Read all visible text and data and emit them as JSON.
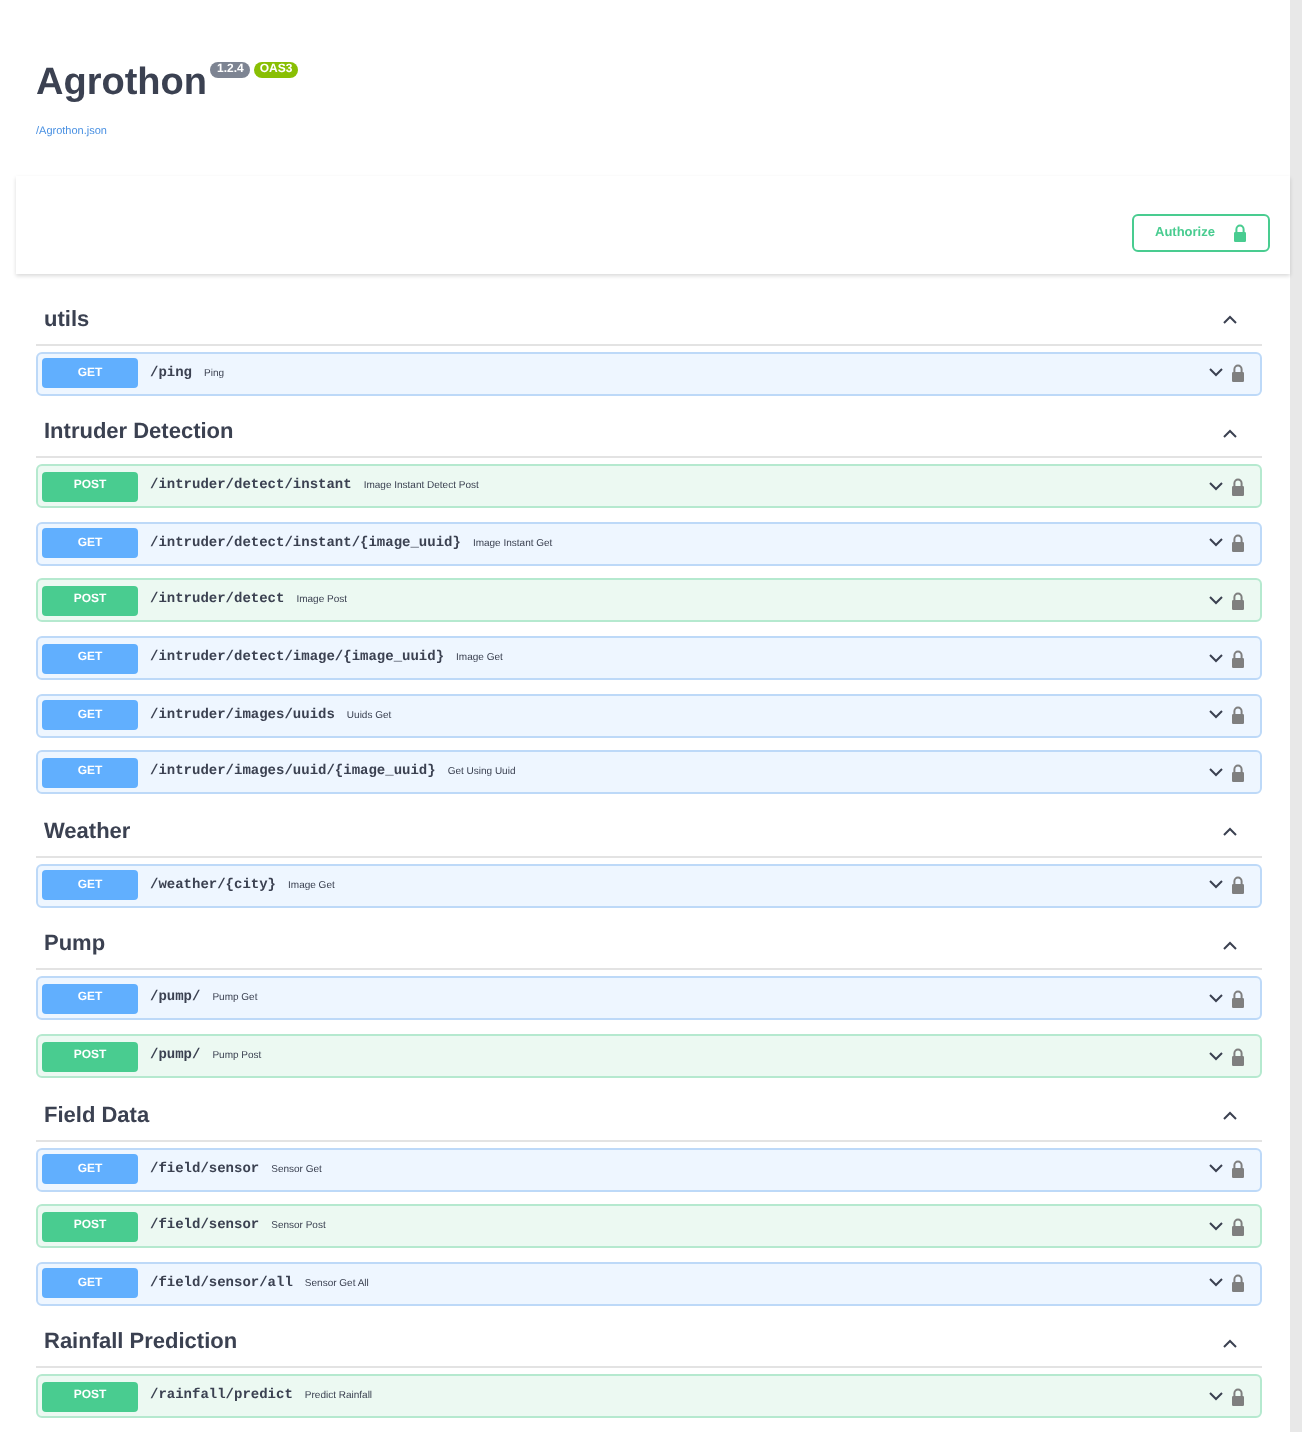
{
  "header": {
    "title": "Agrothon",
    "version": "1.2.4",
    "spec": "OAS3",
    "link": "/Agrothon.json"
  },
  "authorize": {
    "label": "Authorize"
  },
  "sections": [
    {
      "name": "utils",
      "expanded": true,
      "operations": [
        {
          "kind": "get",
          "method": "GET",
          "path": "/ping",
          "summary": "Ping"
        }
      ]
    },
    {
      "name": "Intruder Detection",
      "expanded": true,
      "operations": [
        {
          "kind": "post",
          "method": "POST",
          "path": "/intruder/detect/instant",
          "summary": "Image Instant Detect Post"
        },
        {
          "kind": "get",
          "method": "GET",
          "path": "/intruder/detect/instant/{image_uuid}",
          "summary": "Image Instant Get"
        },
        {
          "kind": "post",
          "method": "POST",
          "path": "/intruder/detect",
          "summary": "Image Post"
        },
        {
          "kind": "get",
          "method": "GET",
          "path": "/intruder/detect/image/{image_uuid}",
          "summary": "Image Get"
        },
        {
          "kind": "get",
          "method": "GET",
          "path": "/intruder/images/uuids",
          "summary": "Uuids Get"
        },
        {
          "kind": "get",
          "method": "GET",
          "path": "/intruder/images/uuid/{image_uuid}",
          "summary": "Get Using Uuid"
        }
      ]
    },
    {
      "name": "Weather",
      "expanded": true,
      "operations": [
        {
          "kind": "get",
          "method": "GET",
          "path": "/weather/{city}",
          "summary": "Image Get"
        }
      ]
    },
    {
      "name": "Pump",
      "expanded": true,
      "operations": [
        {
          "kind": "get",
          "method": "GET",
          "path": "/pump/",
          "summary": "Pump Get"
        },
        {
          "kind": "post",
          "method": "POST",
          "path": "/pump/",
          "summary": "Pump Post"
        }
      ]
    },
    {
      "name": "Field Data",
      "expanded": true,
      "operations": [
        {
          "kind": "get",
          "method": "GET",
          "path": "/field/sensor",
          "summary": "Sensor Get"
        },
        {
          "kind": "post",
          "method": "POST",
          "path": "/field/sensor",
          "summary": "Sensor Post"
        },
        {
          "kind": "get",
          "method": "GET",
          "path": "/field/sensor/all",
          "summary": "Sensor Get All"
        }
      ]
    },
    {
      "name": "Rainfall Prediction",
      "expanded": true,
      "operations": [
        {
          "kind": "post",
          "method": "POST",
          "path": "/rainfall/predict",
          "summary": "Predict Rainfall"
        }
      ]
    }
  ]
}
